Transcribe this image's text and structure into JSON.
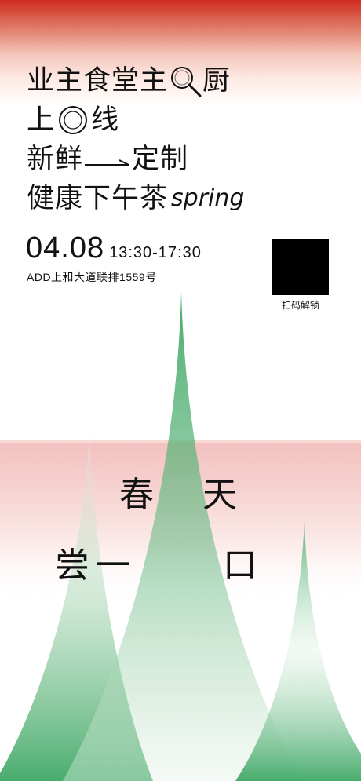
{
  "headline": {
    "line1_a": "业主食堂主",
    "line1_icon": "magnifier-icon",
    "line1_b": "厨",
    "line2_a": "上",
    "line2_icon": "plate-icon",
    "line2_b": "线",
    "line3_a": "新鲜",
    "line3_icon": "arrow-icon",
    "line3_b": "定制",
    "line4_a": "健康下午茶",
    "line4_b": "spring"
  },
  "event": {
    "date": "04.08",
    "time": "13:30-17:30",
    "address": "ADD上和大道联排1559号"
  },
  "qr": {
    "label": "扫码解锁"
  },
  "slogan": {
    "c1": "春",
    "c2": "天",
    "c3": "尝",
    "c4": "一",
    "c5": "口"
  },
  "colors": {
    "top_red": "#cf2b1f",
    "mountain_green": "#3fa866",
    "text": "#111111"
  }
}
